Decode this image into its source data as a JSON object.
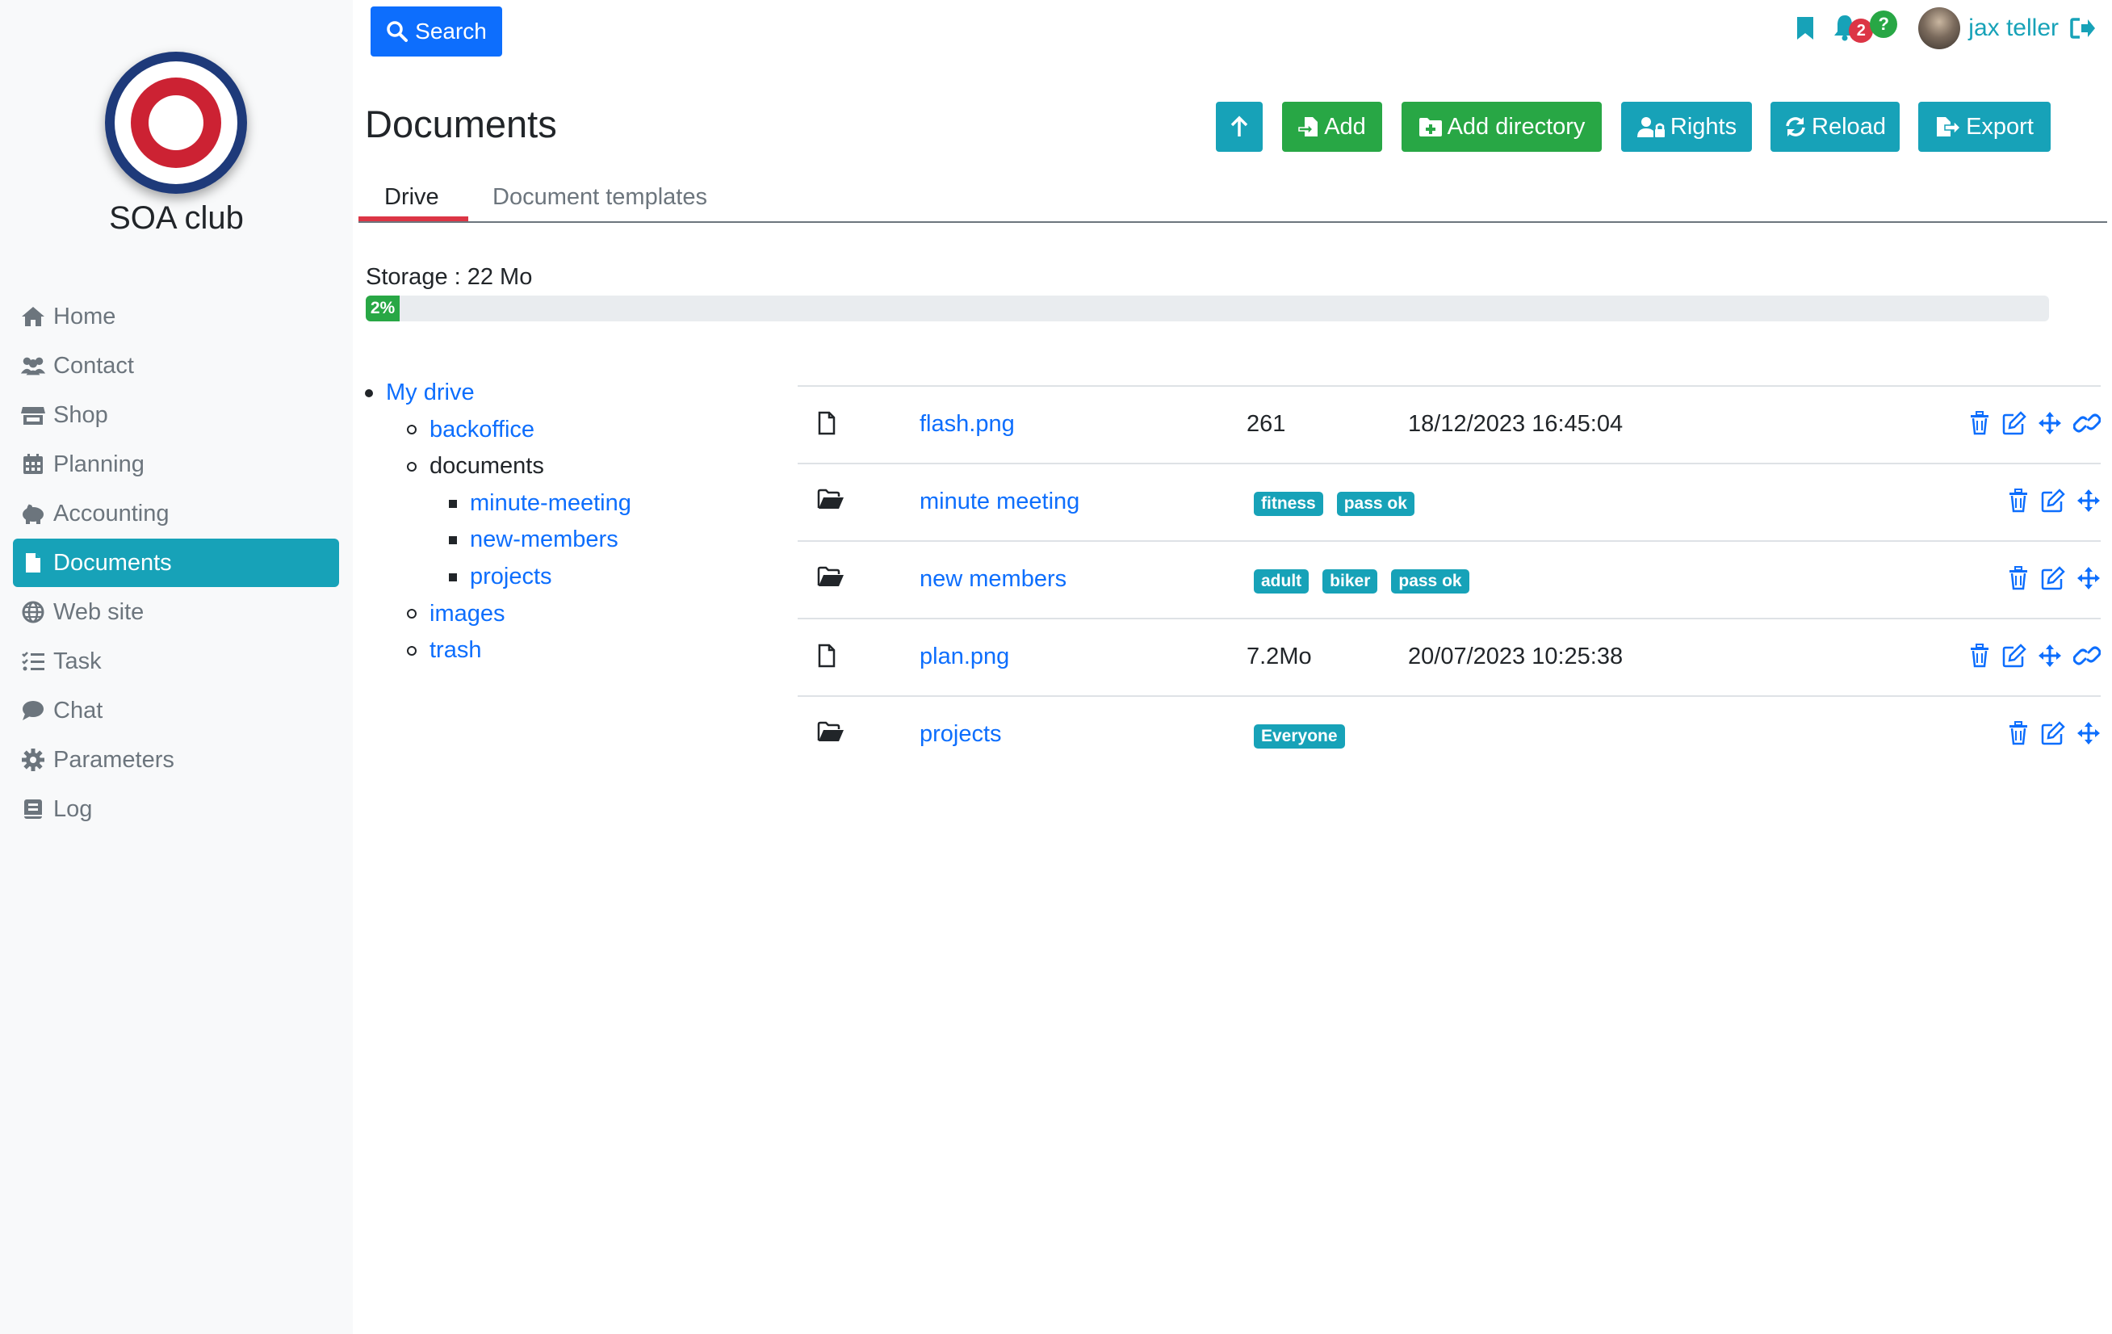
{
  "colors": {
    "primary": "#0d6efd",
    "info": "#17a2b8",
    "success": "#28a745",
    "danger": "#dc3545",
    "muted": "#6c757d",
    "sidebar_bg": "#f8f9fa"
  },
  "sidebar": {
    "club_name": "SOA club",
    "items": [
      {
        "label": "Home",
        "icon": "home-icon"
      },
      {
        "label": "Contact",
        "icon": "users-icon"
      },
      {
        "label": "Shop",
        "icon": "store-icon"
      },
      {
        "label": "Planning",
        "icon": "calendar-icon"
      },
      {
        "label": "Accounting",
        "icon": "piggy-bank-icon"
      },
      {
        "label": "Documents",
        "icon": "file-icon",
        "active": true
      },
      {
        "label": "Web site",
        "icon": "globe-icon"
      },
      {
        "label": "Task",
        "icon": "list-check-icon"
      },
      {
        "label": "Chat",
        "icon": "comment-icon"
      },
      {
        "label": "Parameters",
        "icon": "gear-icon"
      },
      {
        "label": "Log",
        "icon": "book-icon"
      }
    ]
  },
  "topbar": {
    "search_label": "Search",
    "notification_count": "2",
    "help_badge": "?",
    "username": "jax teller"
  },
  "header": {
    "title": "Documents",
    "buttons": {
      "add": "Add",
      "add_directory": "Add directory",
      "rights": "Rights",
      "reload": "Reload",
      "export": "Export"
    }
  },
  "tabs": [
    {
      "label": "Drive",
      "active": true
    },
    {
      "label": "Document templates",
      "active": false
    }
  ],
  "storage": {
    "label": "Storage : 22 Mo",
    "percent_label": "2%",
    "fraction": 0.02
  },
  "tree": [
    {
      "label": "My drive",
      "level": 0,
      "link": true
    },
    {
      "label": "backoffice",
      "level": 1,
      "link": true
    },
    {
      "label": "documents",
      "level": 1,
      "link": false
    },
    {
      "label": "minute-meeting",
      "level": 2,
      "link": true
    },
    {
      "label": "new-members",
      "level": 2,
      "link": true
    },
    {
      "label": "projects",
      "level": 2,
      "link": true
    },
    {
      "label": "images",
      "level": 1,
      "link": true
    },
    {
      "label": "trash",
      "level": 1,
      "link": true
    }
  ],
  "files": [
    {
      "type": "file",
      "name": "flash.png",
      "size": "261",
      "date": "18/12/2023 16:45:04",
      "tags": [],
      "actions": [
        "delete",
        "edit",
        "move",
        "link"
      ]
    },
    {
      "type": "folder",
      "name": "minute meeting",
      "size": "",
      "date": "",
      "tags": [
        "fitness",
        "pass ok"
      ],
      "actions": [
        "delete",
        "edit",
        "move"
      ]
    },
    {
      "type": "folder",
      "name": "new members",
      "size": "",
      "date": "",
      "tags": [
        "adult",
        "biker",
        "pass ok"
      ],
      "actions": [
        "delete",
        "edit",
        "move"
      ]
    },
    {
      "type": "file",
      "name": "plan.png",
      "size": "7.2Mo",
      "date": "20/07/2023 10:25:38",
      "tags": [],
      "actions": [
        "delete",
        "edit",
        "move",
        "link"
      ]
    },
    {
      "type": "folder",
      "name": "projects",
      "size": "",
      "date": "",
      "tags": [
        "Everyone"
      ],
      "actions": [
        "delete",
        "edit",
        "move"
      ]
    }
  ]
}
